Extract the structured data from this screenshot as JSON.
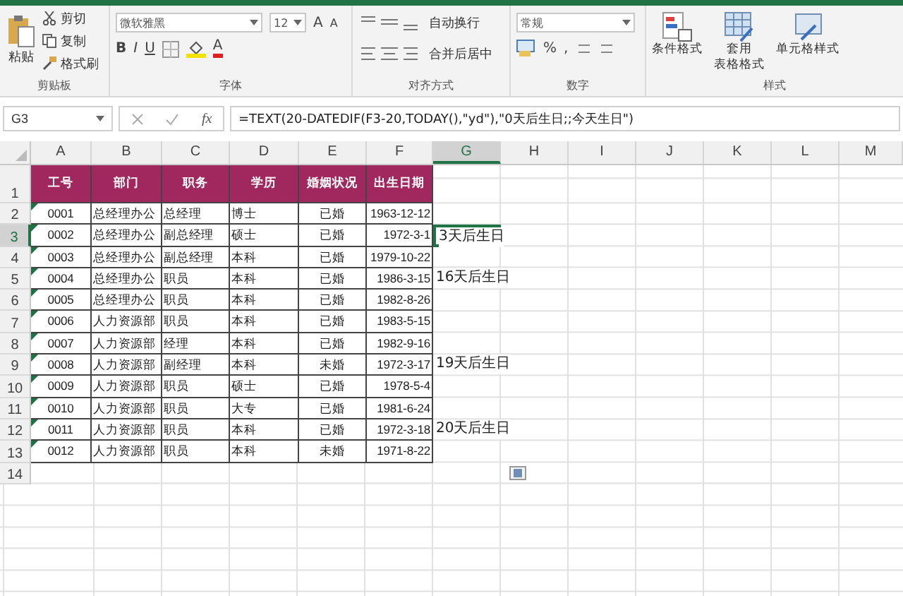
{
  "ribbon": {
    "clipboard": {
      "paste": "粘贴",
      "cut": "剪切",
      "copy": "复制",
      "painter": "格式刷",
      "label": "剪贴板"
    },
    "font": {
      "family": "微软雅黑",
      "size": "12",
      "grow": "A",
      "shrink": "A",
      "bold": "B",
      "italic": "I",
      "underline": "U",
      "color_letter": "A",
      "label": "字体"
    },
    "alignment": {
      "wrap": "自动换行",
      "merge": "合并后居中",
      "label": "对齐方式"
    },
    "number": {
      "format": "常规",
      "percent": "%",
      "comma": ",",
      "label": "数字"
    },
    "styles": {
      "conditional": "条件格式",
      "table_lines": [
        "套用",
        "表格格式"
      ],
      "cell": "单元格样式",
      "label": "样式"
    }
  },
  "formula_bar": {
    "name_box": "G3",
    "fx": "fx",
    "formula": "=TEXT(20-DATEDIF(F3-20,TODAY(),\"yd\"),\"0天后生日;;今天生日\")"
  },
  "columns": [
    {
      "label": "A",
      "selected": false
    },
    {
      "label": "B",
      "selected": false
    },
    {
      "label": "C",
      "selected": false
    },
    {
      "label": "D",
      "selected": false
    },
    {
      "label": "E",
      "selected": false
    },
    {
      "label": "F",
      "selected": false
    },
    {
      "label": "G",
      "selected": true
    },
    {
      "label": "H",
      "selected": false
    },
    {
      "label": "I",
      "selected": false
    },
    {
      "label": "J",
      "selected": false
    },
    {
      "label": "K",
      "selected": false
    },
    {
      "label": "L",
      "selected": false
    },
    {
      "label": "M",
      "selected": false
    }
  ],
  "header_row": {
    "number": "1",
    "cells": [
      "工号",
      "部门",
      "职务",
      "学历",
      "婚姻状况",
      "出生日期"
    ]
  },
  "rows": [
    {
      "number": "2",
      "selected": false,
      "cells": [
        "0001",
        "总经理办公",
        "总经理",
        "博士",
        "已婚",
        "1963-12-12"
      ]
    },
    {
      "number": "3",
      "selected": true,
      "cells": [
        "0002",
        "总经理办公",
        "副总经理",
        "硕士",
        "已婚",
        "1972-3-1"
      ],
      "note": "3天后生日"
    },
    {
      "number": "4",
      "selected": false,
      "cells": [
        "0003",
        "总经理办公",
        "副总经理",
        "本科",
        "已婚",
        "1979-10-22"
      ]
    },
    {
      "number": "5",
      "selected": false,
      "cells": [
        "0004",
        "总经理办公",
        "职员",
        "本科",
        "已婚",
        "1986-3-15"
      ],
      "note": "16天后生日"
    },
    {
      "number": "6",
      "selected": false,
      "cells": [
        "0005",
        "总经理办公",
        "职员",
        "本科",
        "已婚",
        "1982-8-26"
      ]
    },
    {
      "number": "7",
      "selected": false,
      "cells": [
        "0006",
        "人力资源部",
        "职员",
        "本科",
        "已婚",
        "1983-5-15"
      ]
    },
    {
      "number": "8",
      "selected": false,
      "cells": [
        "0007",
        "人力资源部",
        "经理",
        "本科",
        "已婚",
        "1982-9-16"
      ]
    },
    {
      "number": "9",
      "selected": false,
      "cells": [
        "0008",
        "人力资源部",
        "副经理",
        "本科",
        "未婚",
        "1972-3-17"
      ],
      "note": "19天后生日"
    },
    {
      "number": "10",
      "selected": false,
      "cells": [
        "0009",
        "人力资源部",
        "职员",
        "硕士",
        "已婚",
        "1978-5-4"
      ]
    },
    {
      "number": "11",
      "selected": false,
      "cells": [
        "0010",
        "人力资源部",
        "职员",
        "大专",
        "已婚",
        "1981-6-24"
      ]
    },
    {
      "number": "12",
      "selected": false,
      "cells": [
        "0011",
        "人力资源部",
        "职员",
        "本科",
        "已婚",
        "1972-3-18"
      ],
      "note": "20天后生日"
    },
    {
      "number": "13",
      "selected": false,
      "cells": [
        "0012",
        "人力资源部",
        "职员",
        "本科",
        "未婚",
        "1971-8-22"
      ]
    }
  ],
  "extra_rows": [
    "14"
  ]
}
